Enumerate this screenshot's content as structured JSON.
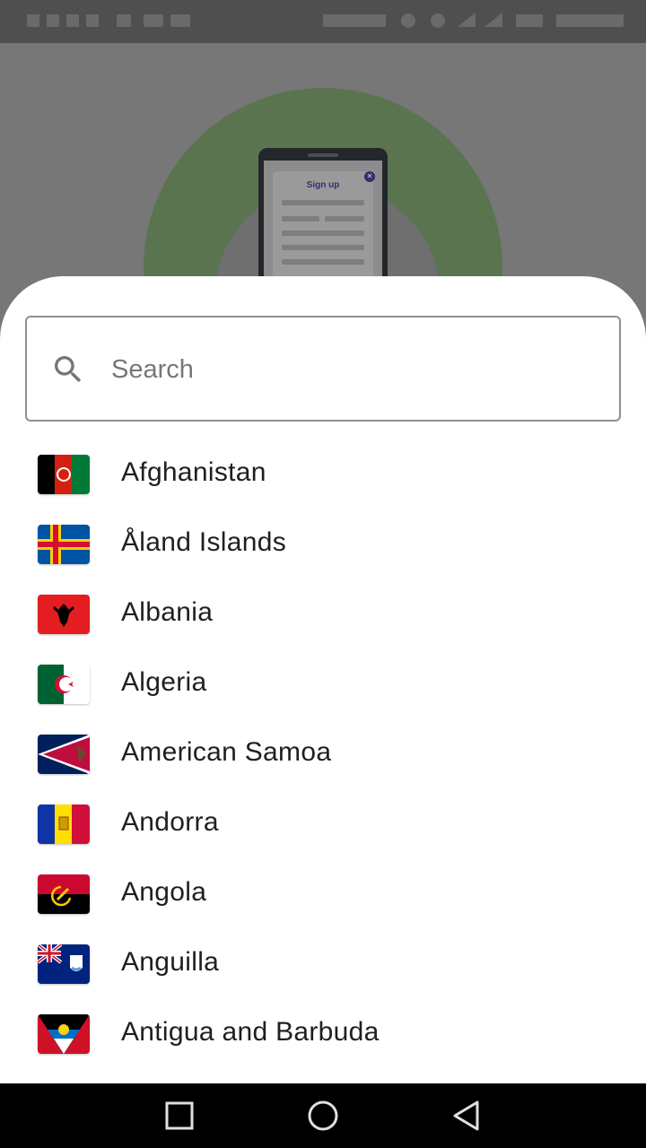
{
  "search": {
    "placeholder": "Search",
    "value": ""
  },
  "illustration": {
    "title": "Sign up"
  },
  "countries": [
    {
      "name": "Afghanistan",
      "flag": "flag-af-icon"
    },
    {
      "name": "Åland Islands",
      "flag": "flag-ax-icon"
    },
    {
      "name": "Albania",
      "flag": "flag-al-icon"
    },
    {
      "name": "Algeria",
      "flag": "flag-dz-icon"
    },
    {
      "name": "American Samoa",
      "flag": "flag-as-icon"
    },
    {
      "name": "Andorra",
      "flag": "flag-ad-icon"
    },
    {
      "name": "Angola",
      "flag": "flag-ao-icon"
    },
    {
      "name": "Anguilla",
      "flag": "flag-ai-icon"
    },
    {
      "name": "Antigua and Barbuda",
      "flag": "flag-ag-icon"
    }
  ],
  "colors": {
    "sheet_bg": "#ffffff",
    "text": "#1f1f1f",
    "border": "#8f8f8f",
    "scrim": "#777777",
    "accent_green": "#5b7450"
  }
}
